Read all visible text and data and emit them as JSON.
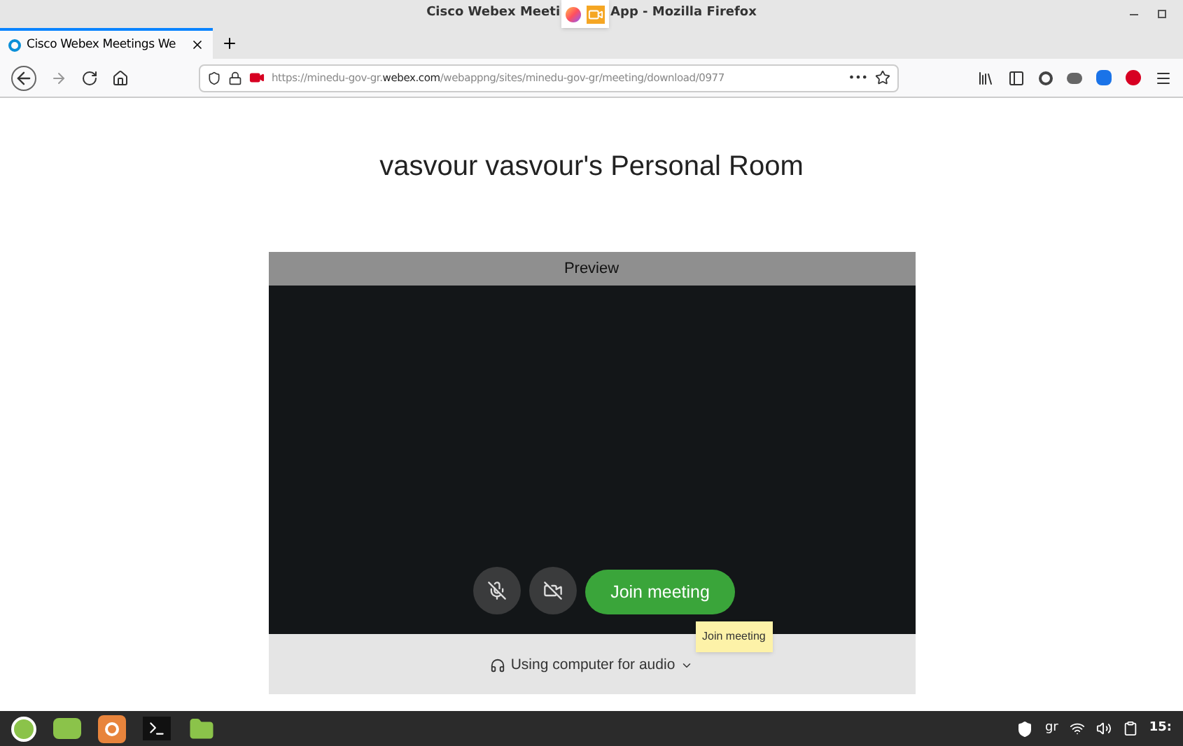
{
  "window": {
    "title_start": "Cisco Webex Meeti",
    "title_end": "App - Mozilla Firefox"
  },
  "tabs": [
    {
      "label": "Cisco Webex Meetings We",
      "selected": true
    }
  ],
  "address_bar": {
    "url": "https://minedu-gov-gr.**webex.com**/webappng/sites/minedu-gov-gr/meeting/download/0977",
    "overflow": "•••"
  },
  "page": {
    "heading": "vasvour vasvour's Personal Room",
    "preview": {
      "header": "Preview",
      "mic": {
        "muted": true
      },
      "camera": {
        "off": true
      },
      "join_button": "Join meeting",
      "tooltip": "Join meeting",
      "audio_option": "Using computer for audio"
    }
  },
  "taskbar": {
    "keyboard_layout": "gr",
    "clock": "15:"
  }
}
